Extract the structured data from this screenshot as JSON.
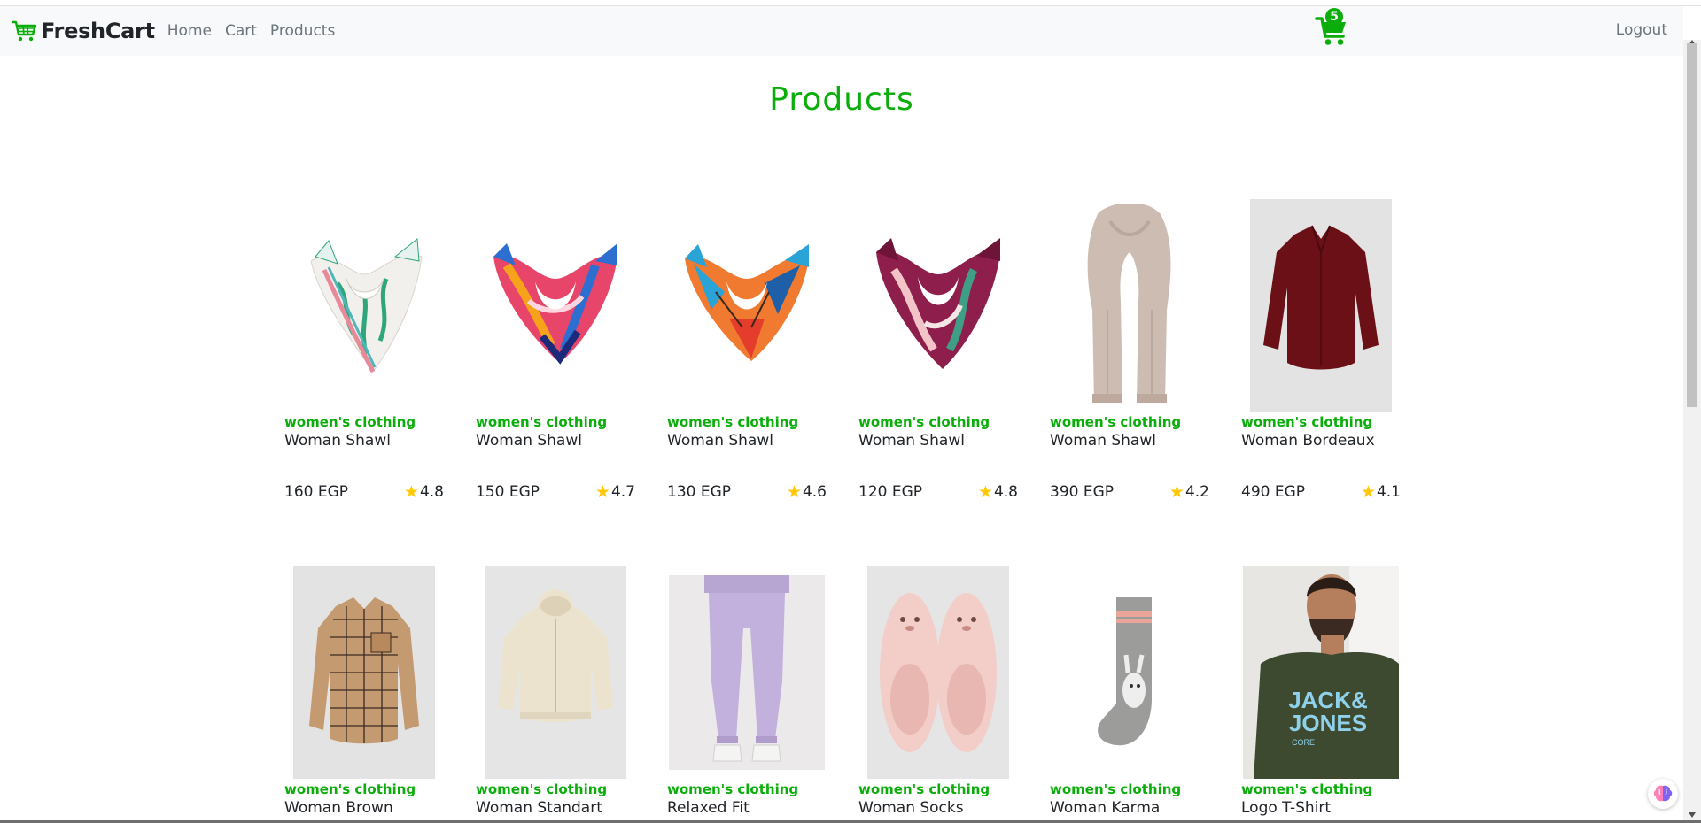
{
  "brand": {
    "name": "FreshCart",
    "icon": "cart-icon"
  },
  "nav": {
    "links": [
      "Home",
      "Cart",
      "Products"
    ],
    "logout": "Logout"
  },
  "cart": {
    "count": "5",
    "icon": "cart-icon",
    "color": "#0aad0a"
  },
  "page": {
    "title": "Products"
  },
  "colors": {
    "accent": "#0aad0a",
    "star": "#ffc908"
  },
  "products": [
    {
      "category": "women's clothing",
      "title": "Woman Shawl",
      "price": "160 EGP",
      "rating": "4.8"
    },
    {
      "category": "women's clothing",
      "title": "Woman Shawl",
      "price": "150 EGP",
      "rating": "4.7"
    },
    {
      "category": "women's clothing",
      "title": "Woman Shawl",
      "price": "130 EGP",
      "rating": "4.6"
    },
    {
      "category": "women's clothing",
      "title": "Woman Shawl",
      "price": "120 EGP",
      "rating": "4.8"
    },
    {
      "category": "women's clothing",
      "title": "Woman Shawl",
      "price": "390 EGP",
      "rating": "4.2"
    },
    {
      "category": "women's clothing",
      "title": "Woman Bordeaux",
      "price": "490 EGP",
      "rating": "4.1"
    },
    {
      "category": "women's clothing",
      "title": "Woman Brown"
    },
    {
      "category": "women's clothing",
      "title": "Woman Standart"
    },
    {
      "category": "women's clothing",
      "title": "Relaxed Fit"
    },
    {
      "category": "women's clothing",
      "title": "Woman Socks"
    },
    {
      "category": "women's clothing",
      "title": "Woman Karma"
    },
    {
      "category": "women's clothing",
      "title": "Logo T-Shirt"
    }
  ],
  "tshirt_print": {
    "line1": "JACK&",
    "line2": "JONES",
    "line3": "CORE"
  }
}
